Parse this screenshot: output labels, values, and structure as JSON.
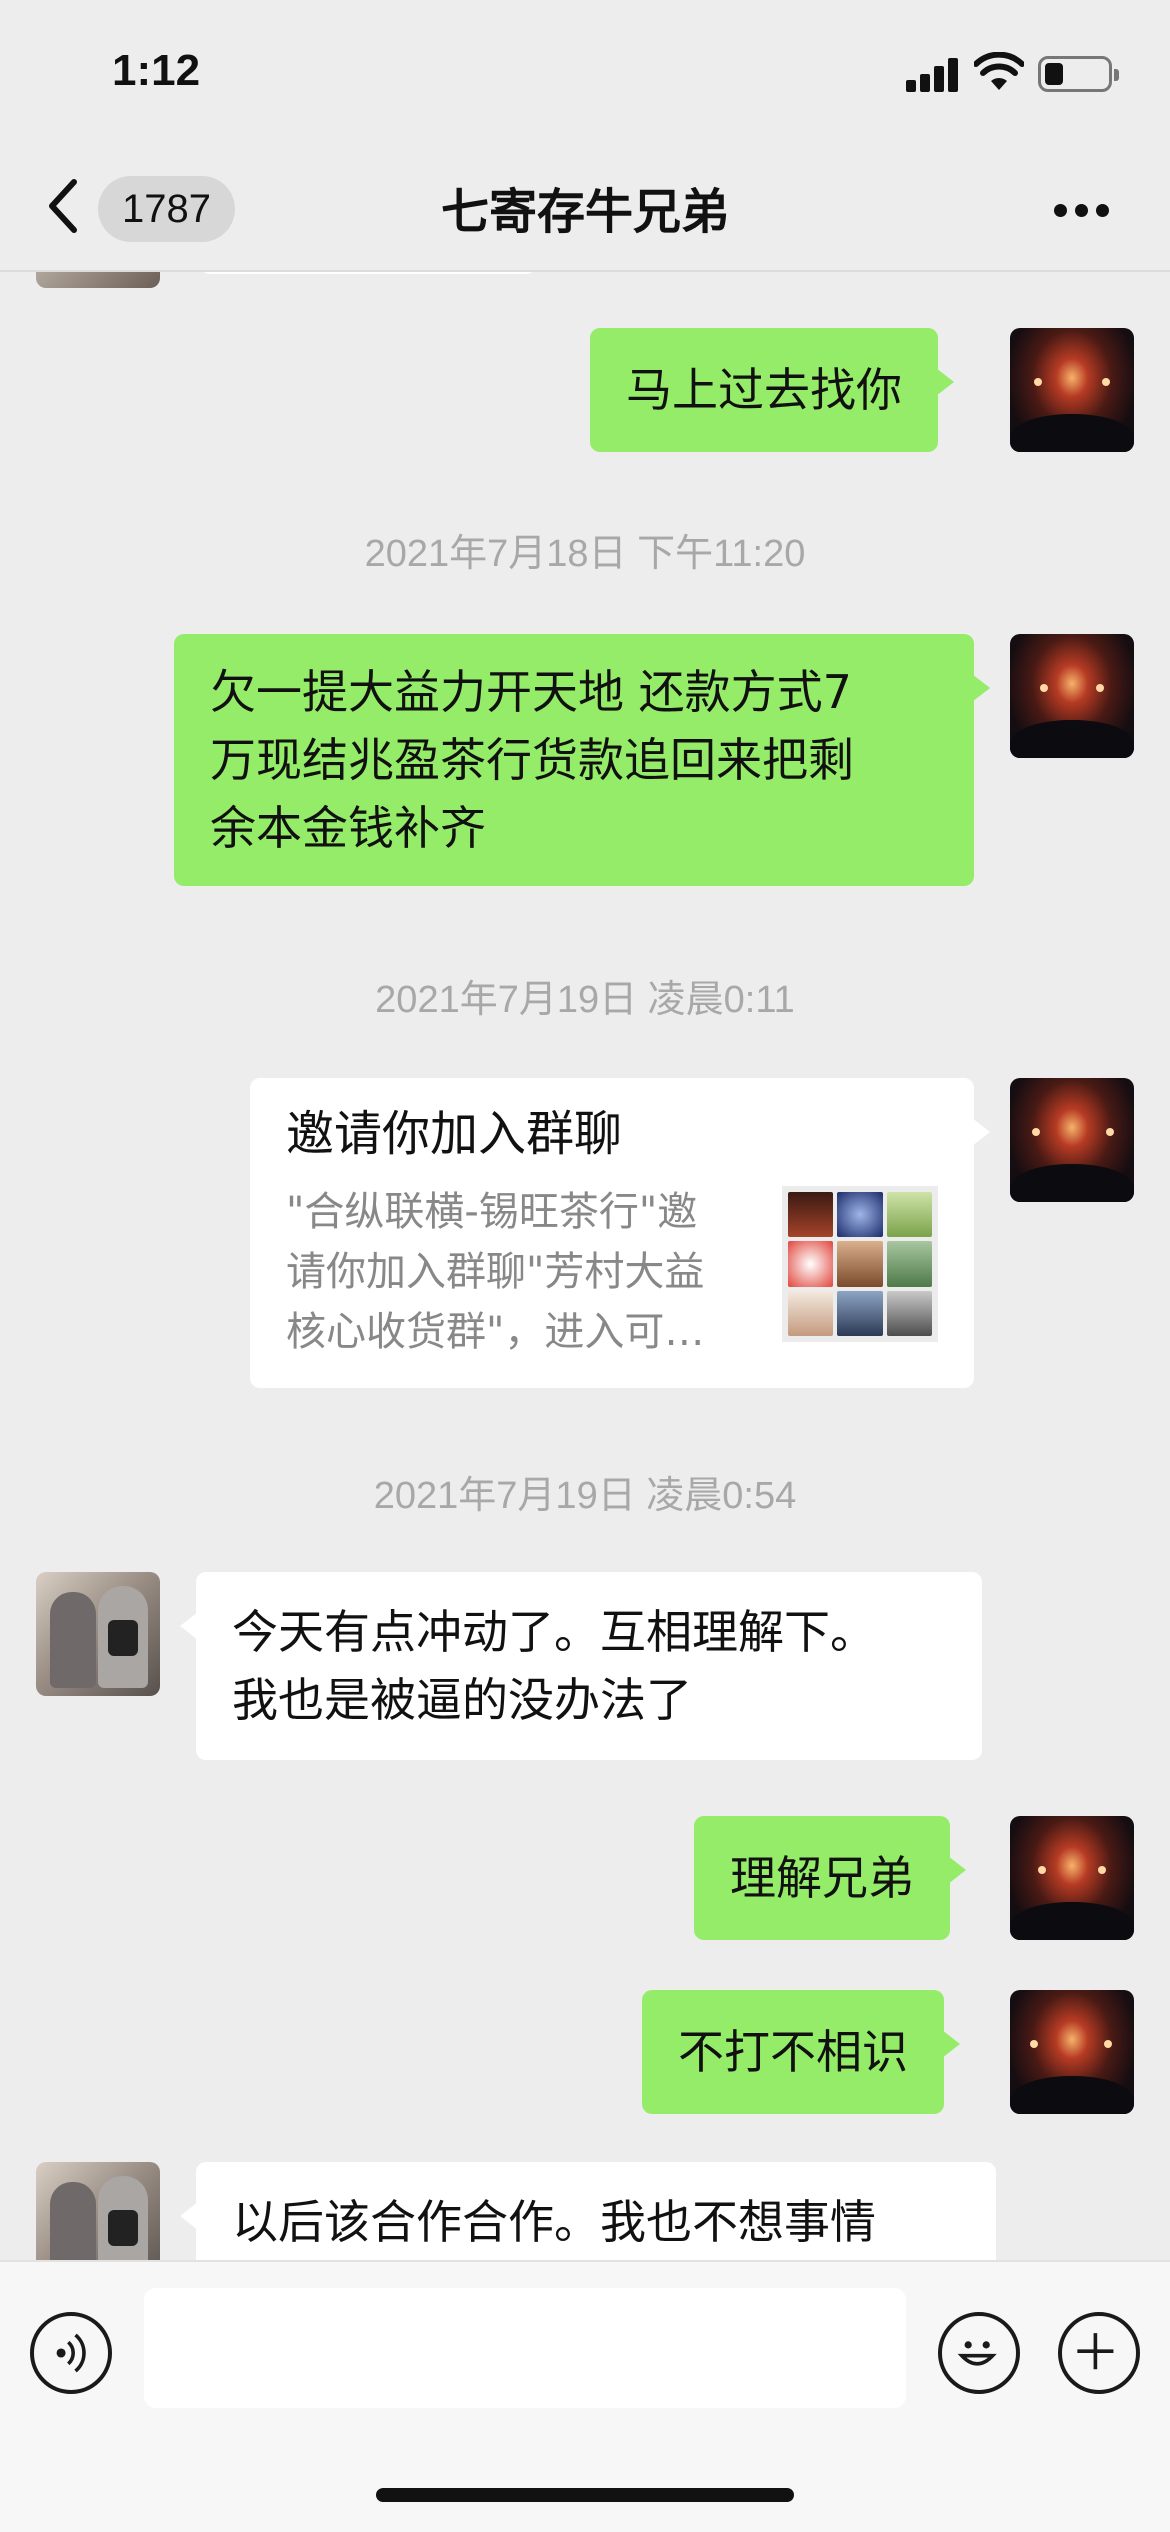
{
  "status_bar": {
    "time": "1:12"
  },
  "nav": {
    "unread_count": "1787",
    "title": "七寄存牛兄弟"
  },
  "messages": [
    {
      "text": "马上过去找你"
    },
    {
      "text": "2021年7月18日 下午11:20"
    },
    {
      "lines": [
        "欠一提大益力开天地 还款方式7",
        "万现结兆盈茶行货款追回来把剩",
        "余本金钱补齐"
      ]
    },
    {
      "text": "2021年7月19日 凌晨0:11"
    },
    {
      "title": "邀请你加入群聊",
      "desc_lines": [
        "\"合纵联横-锡旺茶行\"邀",
        "请你加入群聊\"芳村大益",
        "核心收货群\"，进入可…"
      ]
    },
    {
      "text": "2021年7月19日 凌晨0:54"
    },
    {
      "lines": [
        "今天有点冲动了。互相理解下。",
        "我也是被逼的没办法了"
      ]
    },
    {
      "text": "理解兄弟"
    },
    {
      "text": "不打不相识"
    },
    {
      "text": "以后该合作合作。我也不想事情"
    }
  ],
  "input": {
    "value": "",
    "placeholder": ""
  },
  "colors": {
    "background": "#ededed",
    "self_bubble": "#95ec69",
    "other_bubble": "#ffffff",
    "timestamp": "#a8a8a8"
  },
  "icons": {
    "back": "chevron-left-icon",
    "more": "more-dots-icon",
    "voice": "voice-icon",
    "emoji": "emoji-icon",
    "plus": "plus-icon"
  }
}
